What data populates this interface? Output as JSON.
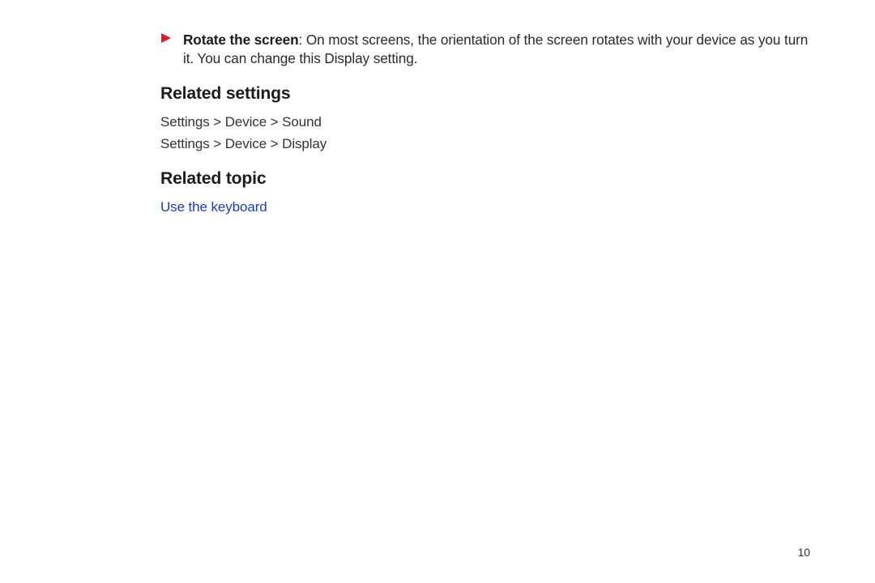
{
  "bullet": {
    "title": "Rotate the screen",
    "body": ": On most screens, the orientation of the screen rotates with your device as you turn it. You can change this Display setting."
  },
  "sections": {
    "related_settings": {
      "heading": "Related settings",
      "paths": [
        "Settings > Device > Sound",
        "Settings > Device > Display"
      ]
    },
    "related_topic": {
      "heading": "Related topic",
      "link": "Use the keyboard"
    }
  },
  "page_number": "10"
}
